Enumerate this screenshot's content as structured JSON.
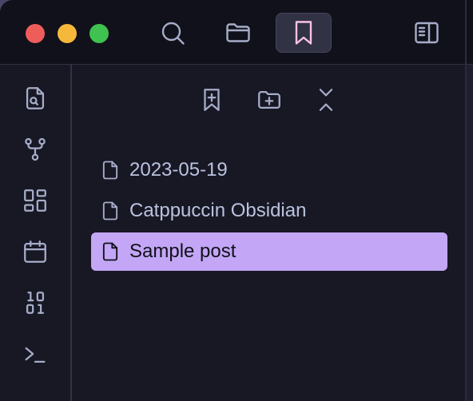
{
  "colors": {
    "titlebar_bg": "#11111b",
    "panel_bg": "#181825",
    "accent": "#c3a6f5",
    "icon": "#a6adc8",
    "active_icon": "#f5c2e7",
    "text": "#bac2de",
    "selected_text": "#11111b"
  },
  "window_controls": [
    "close",
    "minimize",
    "zoom"
  ],
  "titlebar": {
    "buttons": [
      {
        "icon": "search-icon",
        "active": false
      },
      {
        "icon": "folder-icon",
        "active": false
      },
      {
        "icon": "bookmark-icon",
        "active": true
      },
      {
        "icon": "sidebar-toggle-icon",
        "active": false
      }
    ]
  },
  "ribbon": {
    "items": [
      {
        "icon": "file-search-icon"
      },
      {
        "icon": "git-fork-icon"
      },
      {
        "icon": "layout-dashboard-icon"
      },
      {
        "icon": "calendar-icon"
      },
      {
        "icon": "binary-icon"
      },
      {
        "icon": "terminal-icon"
      }
    ]
  },
  "panel": {
    "toolbar": [
      {
        "icon": "bookmark-plus-icon"
      },
      {
        "icon": "folder-plus-icon"
      },
      {
        "icon": "collapse-all-icon"
      }
    ],
    "bookmarks": [
      {
        "label": "2023-05-19",
        "icon": "file-icon",
        "selected": false
      },
      {
        "label": "Catppuccin Obsidian",
        "icon": "file-icon",
        "selected": false
      },
      {
        "label": "Sample post",
        "icon": "file-icon",
        "selected": true
      }
    ]
  }
}
